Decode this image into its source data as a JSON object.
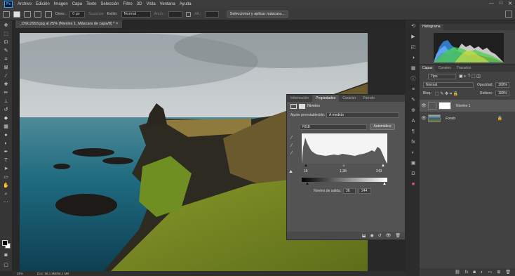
{
  "menubar": {
    "logo": "Ps",
    "items": [
      "Archivo",
      "Edición",
      "Imagen",
      "Capa",
      "Texto",
      "Selección",
      "Filtro",
      "3D",
      "Vista",
      "Ventana",
      "Ayuda"
    ],
    "window_controls": [
      "—",
      "□",
      "✕"
    ]
  },
  "options": {
    "desv_label": "Desv.:",
    "desv_value": "0 px",
    "suavizar_label": "Suavizar",
    "estilo_label": "Estilo:",
    "estilo_value": "Normal",
    "anch_label": "Anch.:",
    "alt_label": "Alt.:",
    "select_mask_button": "Seleccionar y aplicar máscara..."
  },
  "document": {
    "tab_title": "_DSC2993.jpg al 25% (Niveles 1, Máscara de capa/8) * ×",
    "zoom": "25%",
    "doc_info": "Doc: 58,1 MB/58,1 MB"
  },
  "properties": {
    "tabs": [
      "Información",
      "Propiedades",
      "Carácter",
      "Párrafo"
    ],
    "active_tab": 1,
    "title": "Niveles",
    "preset_label": "Ajuste preestablecido:",
    "preset_value": "A medida",
    "channel": "RGB",
    "auto_button": "Automático",
    "input_black": "15",
    "input_gamma": "1,38",
    "input_white": "243",
    "output_label": "Niveles de salida:",
    "output_black": "36",
    "output_white": "244"
  },
  "histogram_panel": {
    "tab": "Histograma"
  },
  "layers_panel": {
    "tabs": [
      "Capas",
      "Canales",
      "Trazados"
    ],
    "filter_value": "Tipo",
    "blend_mode": "Normal",
    "opacity_label": "Opacidad:",
    "opacity_value": "100%",
    "lock_label": "Bloq.:",
    "fill_label": "Relleno:",
    "fill_value": "100%",
    "layers": [
      {
        "name": "Niveles 1",
        "selected": true
      },
      {
        "name": "Fondo",
        "selected": false
      }
    ]
  },
  "colors": {
    "accent": "#31a8ff",
    "panel": "#535353",
    "ui_dark": "#2b2b2b"
  }
}
